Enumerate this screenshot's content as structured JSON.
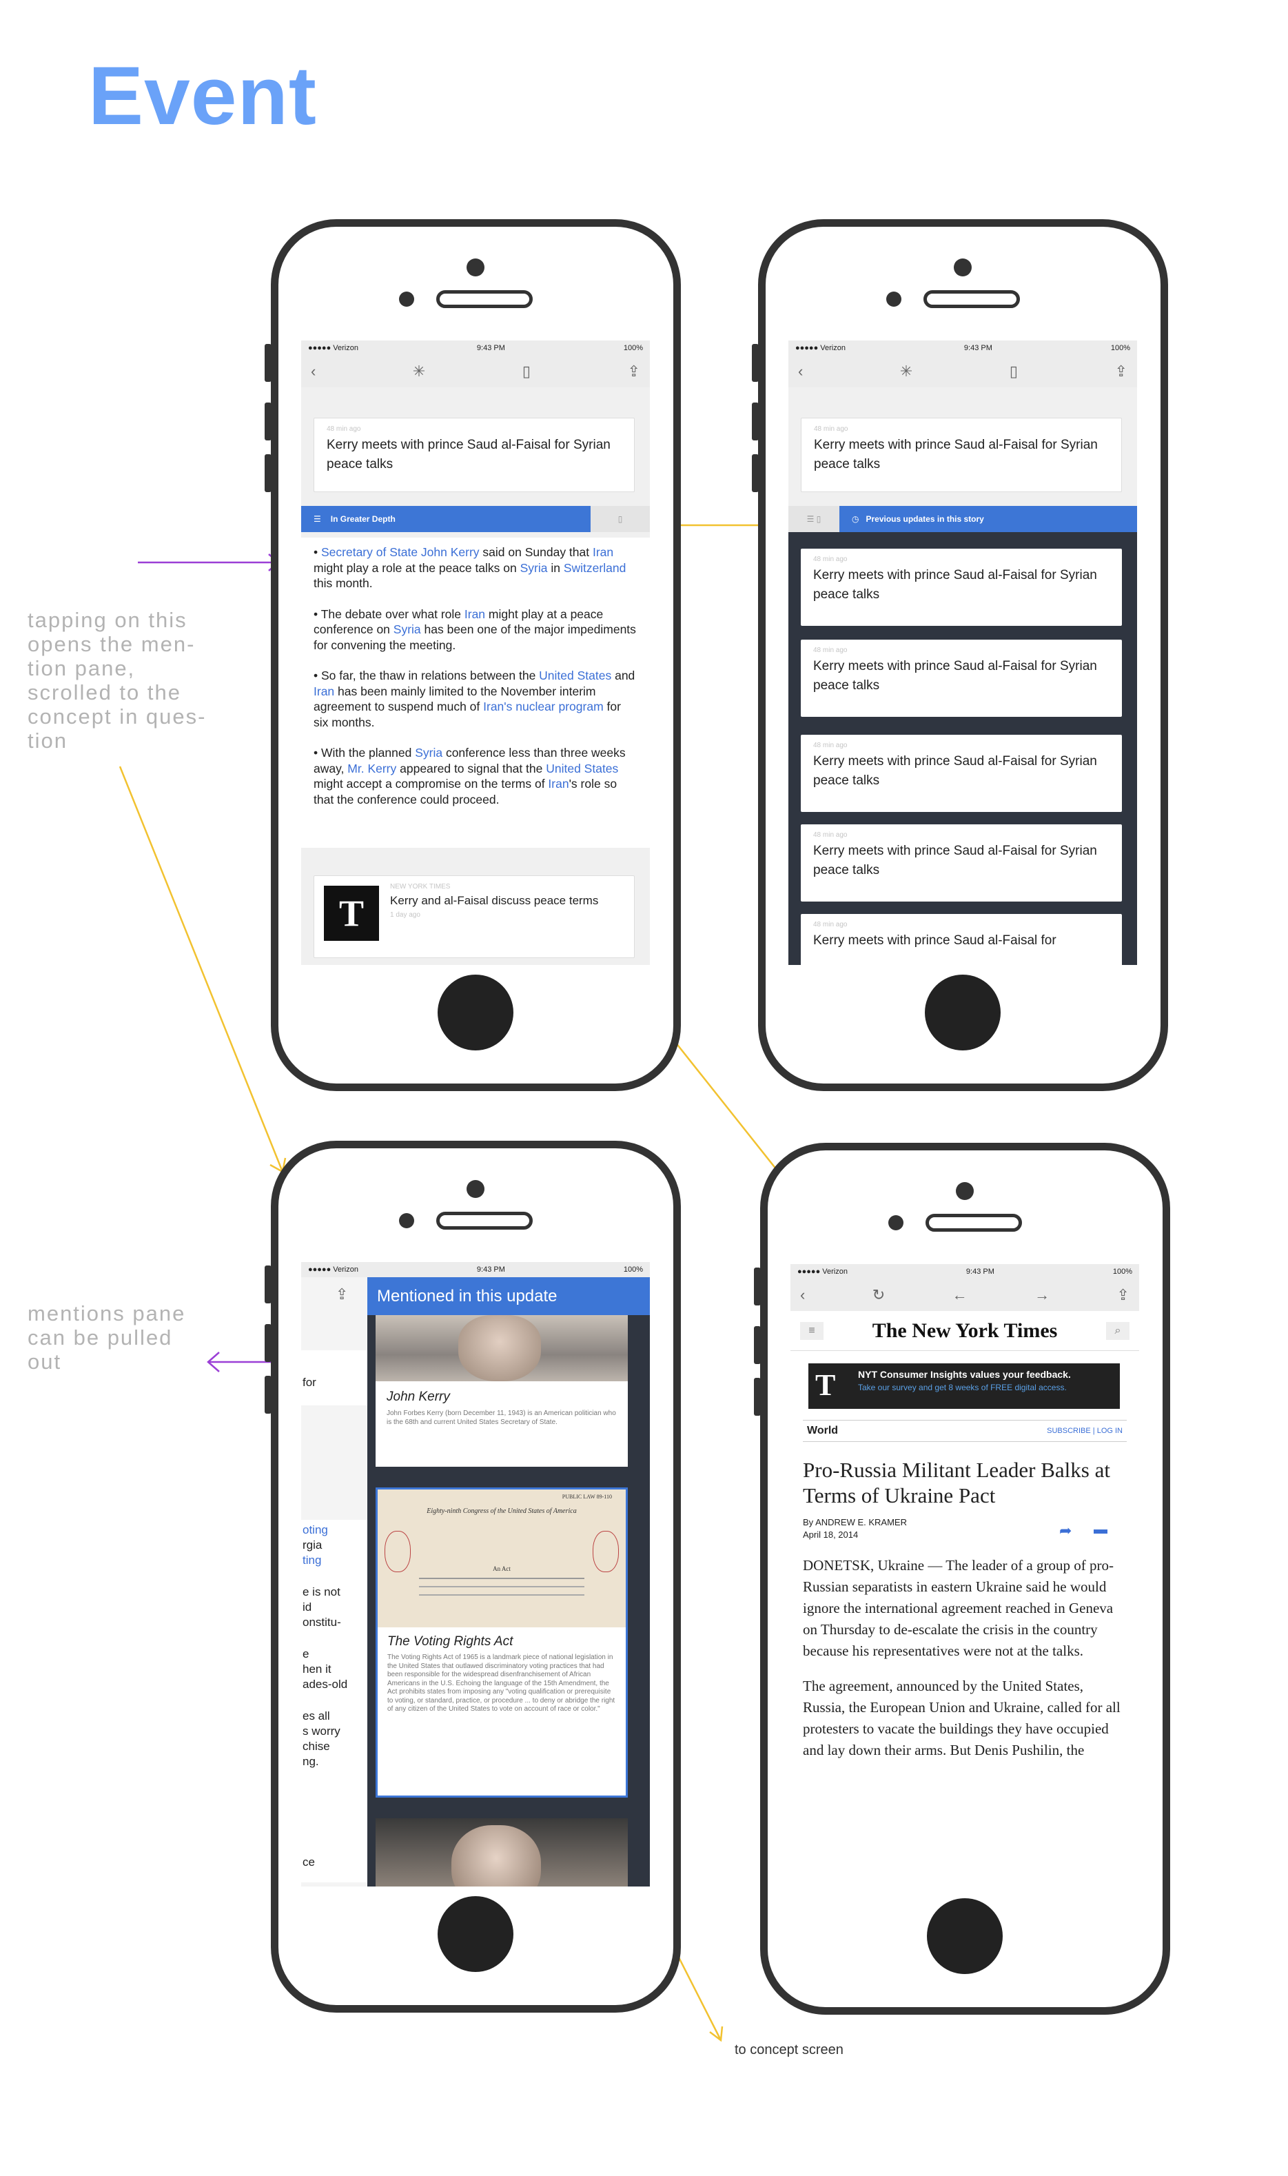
{
  "page": {
    "title": "Event"
  },
  "notes": {
    "tap": "tapping on this opens the men-tion pane, scrolled to the concept in ques-tion",
    "pull": "mentions pane can be pulled out",
    "concept": "to concept screen"
  },
  "status": {
    "carrier": "●●●●● Verizon",
    "time": "9:43 PM",
    "battery": "100%"
  },
  "story": {
    "ago": "48 min ago",
    "headline": "Kerry meets with prince Saud al-Faisal for Syrian peace talks"
  },
  "depth": {
    "label": "In Greater Depth"
  },
  "bullets": [
    {
      "a": "Secretary of State John Kerry",
      "b": " said on Sunday that ",
      "c": "Iran",
      "d": " might play a role at the peace talks on ",
      "e": "Syria",
      "f": " in ",
      "g": "Switzerland",
      "h": " this month."
    },
    {
      "a": "The debate over what role ",
      "b": "Iran",
      "c": " might play at a peace conference on ",
      "d": "Syria",
      "e": " has been one of the major impediments for convening the meeting."
    },
    {
      "a": "So far, the thaw in relations between the ",
      "b": "United States",
      "c": " and ",
      "d": "Iran",
      "e": " has been mainly limited to the November interim agreement to suspend much of ",
      "f": "Iran's nuclear program",
      "g": " for six months."
    },
    {
      "a": "With the planned ",
      "b": "Syria",
      "c": " conference less than three weeks away, ",
      "d": "Mr. Kerry",
      "e": " appeared to signal that the ",
      "f": "United States",
      "g": " might accept a compromise on the terms of ",
      "h": "Iran",
      "i": "'s role so that the conference could proceed."
    }
  ],
  "source": {
    "name": "NEW YORK TIMES",
    "headline": "Kerry and al-Faisal discuss peace terms",
    "ago": "1 day ago",
    "logo": "T"
  },
  "updates": {
    "label": "Previous updates in this story",
    "ago": "48 min ago",
    "headline": "Kerry meets with prince Saud al-Faisal for Syrian peace talks",
    "tail": "Kerry meets with prince Saud al-Faisal for"
  },
  "mentions": {
    "header": "Mentioned in this update",
    "items": [
      {
        "name": "John Kerry",
        "desc": "John Forbes Kerry (born December 11, 1943) is an American politician who is the 68th and current United States Secretary of State."
      },
      {
        "name": "The Voting Rights Act",
        "desc": "The Voting Rights Act of 1965 is a landmark piece of national legislation in the United States that outlawed discriminatory voting practices that had been responsible for the widespread disenfranchisement of African Americans in the U.S. Echoing the language of the 15th Amendment, the Act prohibits states from imposing any \"voting qualification or prerequisite to voting, or standard, practice, or procedure ... to deny or abridge the right of any citizen of the United States to vote on account of race or color.\"",
        "doc_top": "PUBLIC LAW 89-110",
        "doc_title": "Eighty-ninth Congress of the United States of America",
        "doc_act": "An Act"
      }
    ],
    "behind": [
      "for",
      "oting",
      "rgia",
      "ting",
      "e is not",
      "id",
      "onstitu-",
      "e",
      "hen it",
      "ades-old",
      "es all",
      "s worry",
      "chise",
      "ng.",
      "ce"
    ]
  },
  "nyt": {
    "logo": "The New York Times",
    "banner_title": "NYT Consumer Insights values your feedback.",
    "banner_sub": "Take our survey and get 8 weeks of FREE digital access.",
    "section": "World",
    "subscribe": "SUBSCRIBE",
    "login": "LOG IN",
    "headline": "Pro-Russia Militant Leader Balks at Terms of Ukraine Pact",
    "byline": "By ANDREW E. KRAMER",
    "date": "April 18, 2014",
    "p1": "DONETSK, Ukraine — The leader of a group of pro-Russian separatists in eastern Ukraine said he would ignore the international agreement reached in Geneva on Thursday to de-escalate the crisis in the country because his representatives were not at the talks.",
    "p2": "The agreement, announced by the United States, Russia, the European Union and Ukraine, called for all protesters to vacate the buildings they have occupied and lay down their arms. But Denis Pushilin, the"
  }
}
